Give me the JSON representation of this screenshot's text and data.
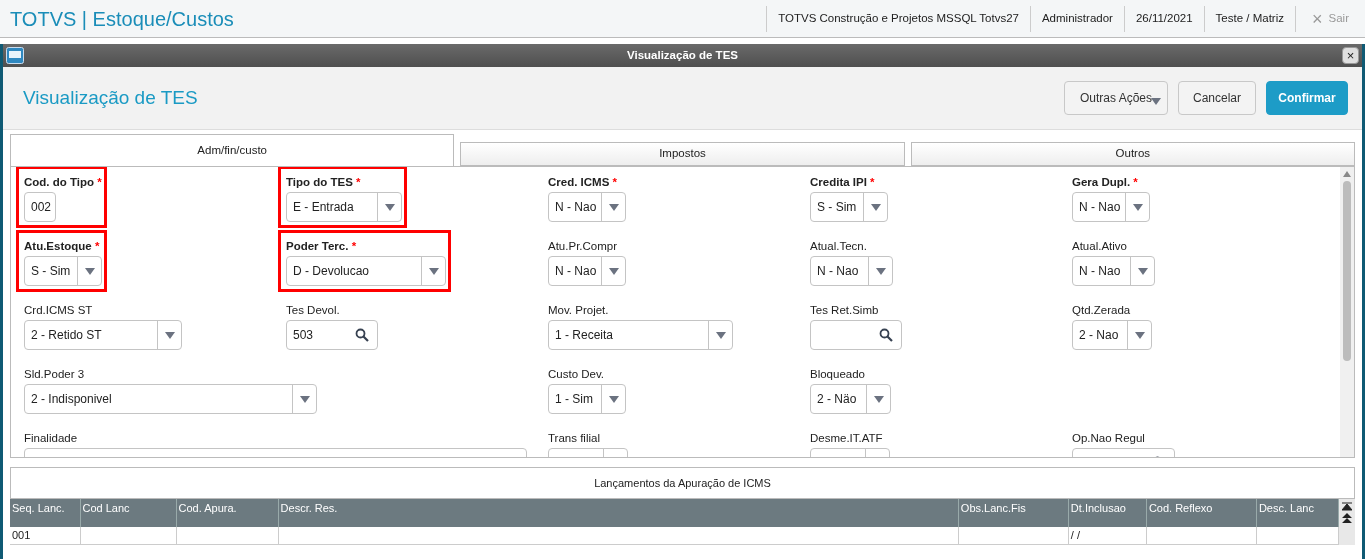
{
  "app_bar": {
    "title": "TOTVS | Estoque/Custos",
    "items": [
      "TOTVS Construção e Projetos MSSQL Totvs27",
      "Administrador",
      "26/11/2021",
      "Teste / Matriz"
    ],
    "exit": {
      "icon": "×",
      "label": "Sair",
      "disabled": true
    }
  },
  "window": {
    "title": "Visualização de TES",
    "close": "×"
  },
  "header": {
    "title": "Visualização de TES",
    "buttons": [
      {
        "label": "Outras Ações",
        "kind": "menu"
      },
      {
        "label": "Cancelar",
        "kind": "normal"
      },
      {
        "label": "Confirmar",
        "kind": "primary"
      }
    ]
  },
  "tabs": [
    {
      "label": "Adm/fin/custo",
      "selected": true
    },
    {
      "label": "Impostos",
      "selected": false
    },
    {
      "label": "Outros",
      "selected": false
    }
  ],
  "form_rows": [
    [
      {
        "kind": "text",
        "label": "Cod. do Tipo",
        "asterisk": "*",
        "required": true,
        "highlighted": true,
        "value": "002"
      },
      {
        "kind": "select",
        "label": "Tipo do TES",
        "asterisk": "*",
        "required": true,
        "highlighted": true,
        "value": "E - Entrada"
      },
      {
        "kind": "select",
        "label": "Cred. ICMS",
        "asterisk": "*",
        "required": true,
        "highlighted": false,
        "value": "N - Nao"
      },
      {
        "kind": "select",
        "label": "Credita IPI",
        "asterisk": "*",
        "required": true,
        "highlighted": false,
        "value": "S - Sim"
      },
      {
        "kind": "select",
        "label": "Gera Dupl.",
        "asterisk": "*",
        "required": true,
        "highlighted": false,
        "value": "N - Nao"
      }
    ],
    [
      {
        "kind": "select",
        "label": "Atu.Estoque",
        "asterisk": "*",
        "required": true,
        "highlighted": true,
        "value": "S - Sim"
      },
      {
        "kind": "select",
        "label": "Poder Terc.",
        "asterisk": "*",
        "required": true,
        "highlighted": true,
        "value": "D - Devolucao"
      },
      {
        "kind": "select",
        "label": "Atu.Pr.Compr",
        "required": false,
        "highlighted": false,
        "value": "N - Nao"
      },
      {
        "kind": "select",
        "label": "Atual.Tecn.",
        "required": false,
        "highlighted": false,
        "value": "N - Nao"
      },
      {
        "kind": "select",
        "label": "Atual.Ativo",
        "required": false,
        "highlighted": false,
        "value": "N - Nao"
      }
    ],
    [
      {
        "kind": "select",
        "label": "Crd.ICMS ST",
        "required": false,
        "highlighted": false,
        "value": "2 - Retido ST"
      },
      {
        "kind": "lookup",
        "label": "Tes Devol.",
        "required": false,
        "highlighted": false,
        "value": "503"
      },
      {
        "kind": "select",
        "label": "Mov. Projet.",
        "required": false,
        "highlighted": false,
        "value": "1 - Receita"
      },
      {
        "kind": "lookup",
        "label": "Tes Ret.Simb",
        "required": false,
        "highlighted": false
      },
      {
        "kind": "select",
        "label": "Qtd.Zerada",
        "required": false,
        "highlighted": false,
        "value": "2 - Nao"
      }
    ],
    [
      {
        "kind": "select",
        "label": "Sld.Poder 3",
        "required": false,
        "highlighted": false,
        "value": "2 - Indisponivel"
      },
      {
        "kind": "empty"
      },
      {
        "kind": "select",
        "label": "Custo Dev.",
        "required": false,
        "highlighted": false,
        "value": "1 - Sim"
      },
      {
        "kind": "select",
        "label": "Bloqueado",
        "required": false,
        "highlighted": false,
        "value": "2 - Näo"
      },
      {
        "kind": "empty"
      }
    ],
    [
      {
        "kind": "text",
        "label": "Finalidade",
        "required": false,
        "highlighted": false
      },
      {
        "kind": "empty"
      },
      {
        "kind": "select",
        "label": "Trans filial",
        "required": false,
        "highlighted": false
      },
      {
        "kind": "select",
        "label": "Desme.IT.ATF",
        "required": false,
        "highlighted": false
      },
      {
        "kind": "lookup",
        "label": "Op.Nao Regul",
        "required": false,
        "highlighted": false
      }
    ]
  ],
  "grid": {
    "title": "Lançamentos da Apuração de ICMS",
    "columns": [
      "Seq. Lanc.",
      "Cod Lanc",
      "Cod. Apura.",
      "Descr. Res.",
      "Obs.Lanc.Fis",
      "Dt.Inclusao",
      "Cod. Reflexo",
      "Desc. Lanc"
    ],
    "rows": [
      [
        "001",
        "",
        "",
        "",
        "",
        "/ /",
        "",
        ""
      ]
    ]
  }
}
